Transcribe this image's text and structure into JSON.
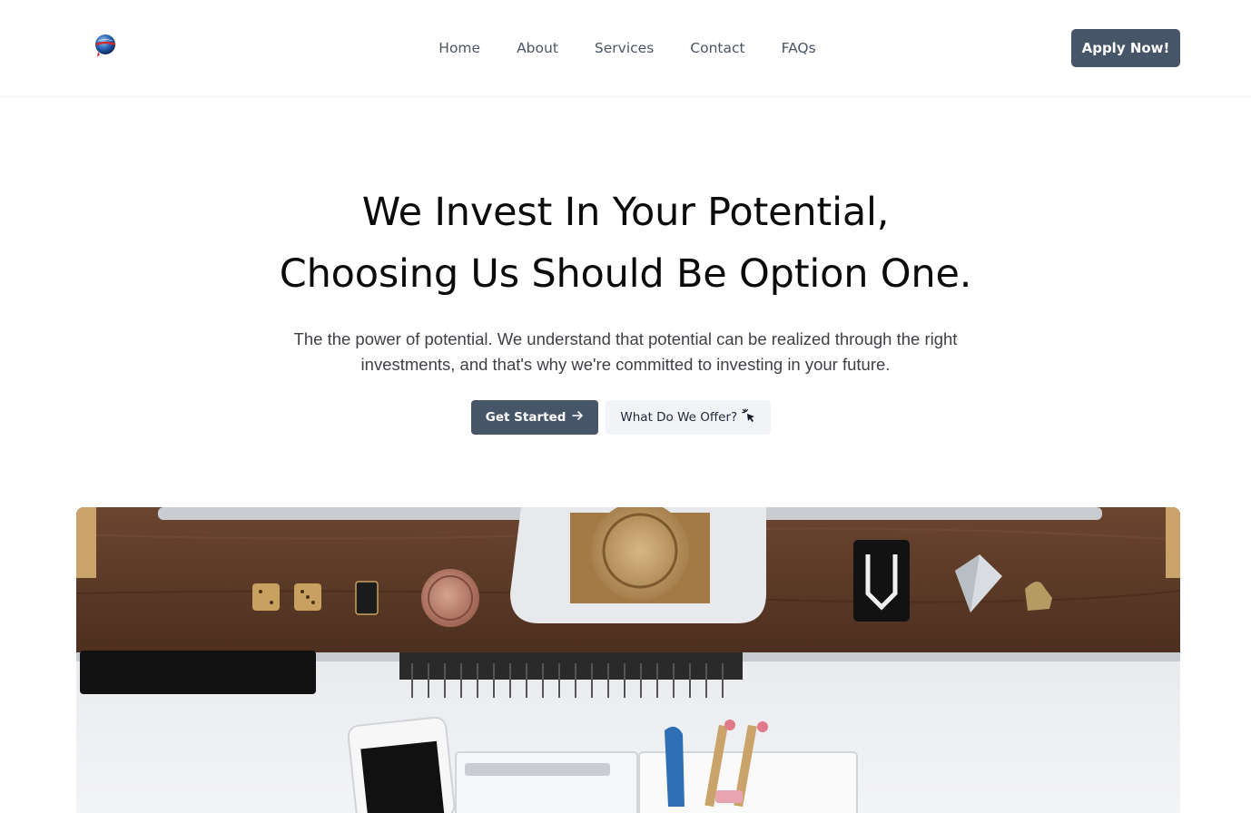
{
  "header": {
    "logo_icon": "globe-logo-icon",
    "nav": [
      {
        "label": "Home"
      },
      {
        "label": "About"
      },
      {
        "label": "Services"
      },
      {
        "label": "Contact"
      },
      {
        "label": "FAQs"
      }
    ],
    "apply_label": "Apply Now!"
  },
  "hero": {
    "title_line1": "We Invest In Your Potential,",
    "title_line2": "Choosing Us Should Be Option One.",
    "description": "The the power of potential. We understand that potential can be realized through the right investments, and that's why we're committed to investing in your future.",
    "primary_cta": "Get Started",
    "primary_cta_icon": "arrow-right-icon",
    "secondary_cta": "What Do We Offer?",
    "secondary_cta_icon": "cursor-click-icon"
  },
  "image": {
    "icon": "desk-photo",
    "colors": {
      "wood": "#5b3a26",
      "desk": "#eceef1",
      "brass": "#b8925a"
    }
  },
  "colors": {
    "accent": "#475569",
    "secondary_bg": "#f1f3f6",
    "text": "#0b0b0b",
    "muted": "#4b5563"
  }
}
